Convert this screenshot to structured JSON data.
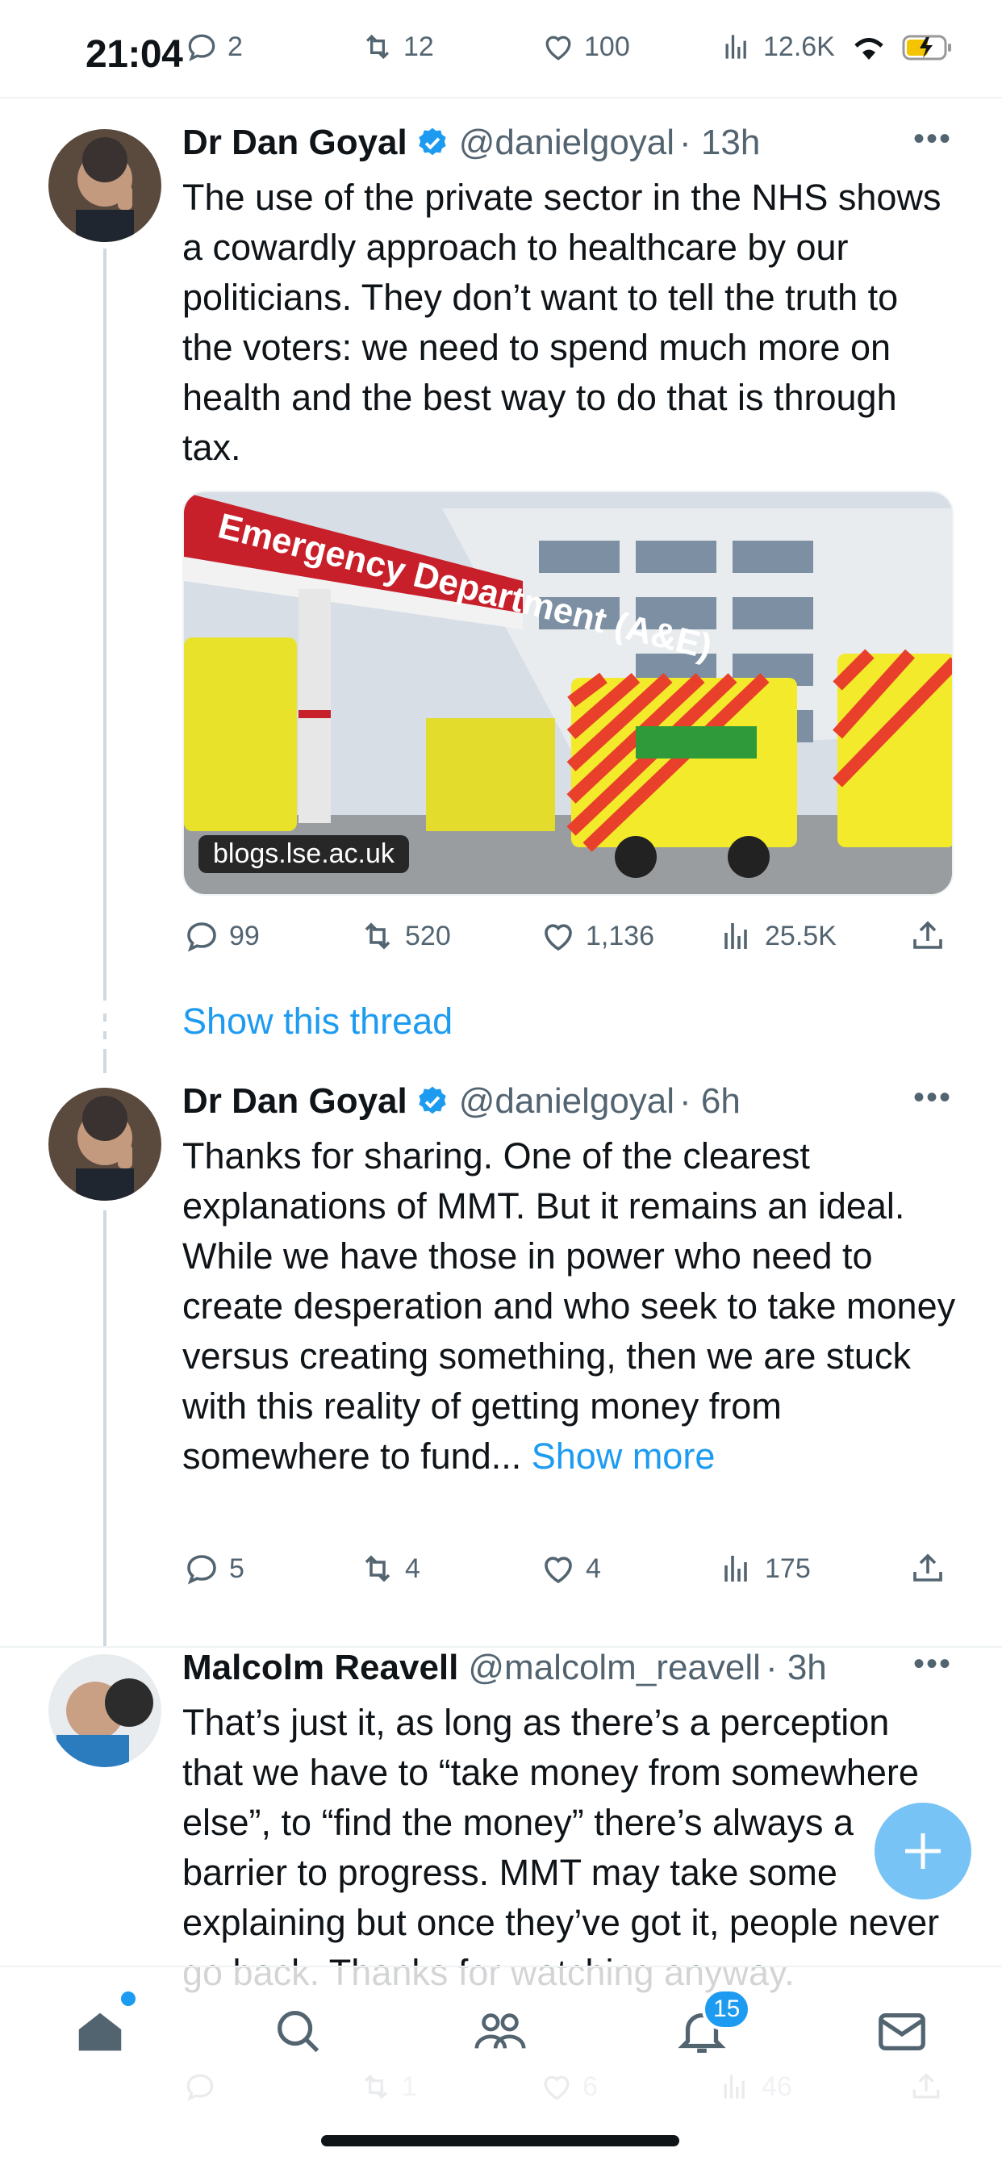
{
  "status_bar": {
    "time": "21:04"
  },
  "top_actions": {
    "replies": "2",
    "reposts": "12",
    "likes": "100",
    "views": "12.6K"
  },
  "tweets": [
    {
      "author": "Dr Dan Goyal",
      "handle": "@danielgoyal",
      "time": "· 13h",
      "text": "The use of the private sector in the NHS shows a cowardly approach to healthcare by our politicians. They don’t want to tell the truth to the voters: we need to spend much more on health and the best way to do that is through tax.",
      "media_source": "blogs.lse.ac.uk",
      "media_sign": "Emergency Department (A&E)",
      "replies": "99",
      "reposts": "520",
      "likes": "1,136",
      "views": "25.5K"
    },
    {
      "author": "Dr Dan Goyal",
      "handle": "@danielgoyal",
      "time": "· 6h",
      "text": "Thanks for sharing. One of the clearest explanations of MMT. But it remains an ideal. While we have those in power who need to create desperation and who seek to take money versus creating something, then we are stuck with this reality of getting money from somewhere to fund...",
      "show_more": "Show more",
      "replies": "5",
      "reposts": "4",
      "likes": "4",
      "views": "175"
    },
    {
      "author": "Malcolm Reavell",
      "handle": "@malcolm_reavell",
      "time": "· 3h",
      "text": "That’s just it, as long as there’s a perception that we have to “take money from somewhere else”, to “find the money” there’s always a barrier to progress. MMT may take some explaining but once they’ve got it, people never go back. Thanks for watching anyway.",
      "replies": "",
      "reposts": "1",
      "likes": "6",
      "views": "46"
    }
  ],
  "show_thread": "Show this thread",
  "tabbar": {
    "notifications_badge": "15"
  },
  "colors": {
    "accent": "#1d9bf0",
    "text": "#0f1419",
    "muted": "#536471"
  }
}
